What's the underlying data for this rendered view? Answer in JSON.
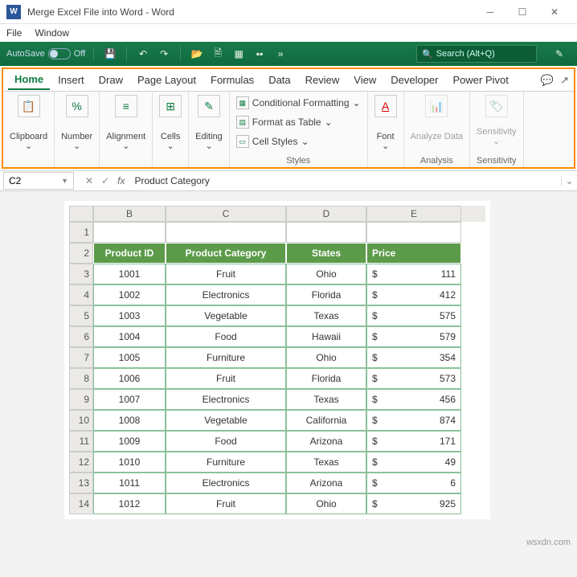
{
  "title": "Merge Excel File into Word - Word",
  "menus": {
    "file": "File",
    "window": "Window"
  },
  "qat": {
    "autosave": "AutoSave",
    "off": "Off",
    "search_placeholder": "Search (Alt+Q)"
  },
  "tabs": {
    "home": "Home",
    "insert": "Insert",
    "draw": "Draw",
    "page_layout": "Page Layout",
    "formulas": "Formulas",
    "data": "Data",
    "review": "Review",
    "view": "View",
    "developer": "Developer",
    "power_pivot": "Power Pivot"
  },
  "groups": {
    "clipboard": "Clipboard",
    "number": "Number",
    "alignment": "Alignment",
    "cells": "Cells",
    "editing": "Editing",
    "cond_fmt": "Conditional Formatting",
    "fmt_table": "Format as Table",
    "cell_styles": "Cell Styles",
    "styles": "Styles",
    "font": "Font",
    "analyze": "Analyze Data",
    "analysis": "Analysis",
    "sensitivity": "Sensitivity",
    "sensitivity_title": "Sensitivity"
  },
  "formula_bar": {
    "cell_ref": "C2",
    "fx": "fx",
    "value": "Product Category"
  },
  "sheet": {
    "cols": [
      "B",
      "C",
      "D",
      "E"
    ],
    "header": {
      "b": "Product ID",
      "c": "Product Category",
      "d": "States",
      "e": "Price"
    },
    "rows": [
      {
        "n": "1"
      },
      {
        "n": "2",
        "header": true
      },
      {
        "n": "3",
        "b": "1001",
        "c": "Fruit",
        "d": "Ohio",
        "cur": "$",
        "e": "111"
      },
      {
        "n": "4",
        "b": "1002",
        "c": "Electronics",
        "d": "Florida",
        "cur": "$",
        "e": "412"
      },
      {
        "n": "5",
        "b": "1003",
        "c": "Vegetable",
        "d": "Texas",
        "cur": "$",
        "e": "575"
      },
      {
        "n": "6",
        "b": "1004",
        "c": "Food",
        "d": "Hawaii",
        "cur": "$",
        "e": "579"
      },
      {
        "n": "7",
        "b": "1005",
        "c": "Furniture",
        "d": "Ohio",
        "cur": "$",
        "e": "354"
      },
      {
        "n": "8",
        "b": "1006",
        "c": "Fruit",
        "d": "Florida",
        "cur": "$",
        "e": "573"
      },
      {
        "n": "9",
        "b": "1007",
        "c": "Electronics",
        "d": "Texas",
        "cur": "$",
        "e": "456"
      },
      {
        "n": "10",
        "b": "1008",
        "c": "Vegetable",
        "d": "California",
        "cur": "$",
        "e": "874"
      },
      {
        "n": "11",
        "b": "1009",
        "c": "Food",
        "d": "Arizona",
        "cur": "$",
        "e": "171"
      },
      {
        "n": "12",
        "b": "1010",
        "c": "Furniture",
        "d": "Texas",
        "cur": "$",
        "e": "49"
      },
      {
        "n": "13",
        "b": "1011",
        "c": "Electronics",
        "d": "Arizona",
        "cur": "$",
        "e": "6"
      },
      {
        "n": "14",
        "b": "1012",
        "c": "Fruit",
        "d": "Ohio",
        "cur": "$",
        "e": "925"
      }
    ]
  },
  "watermark": "wsxdn.com"
}
